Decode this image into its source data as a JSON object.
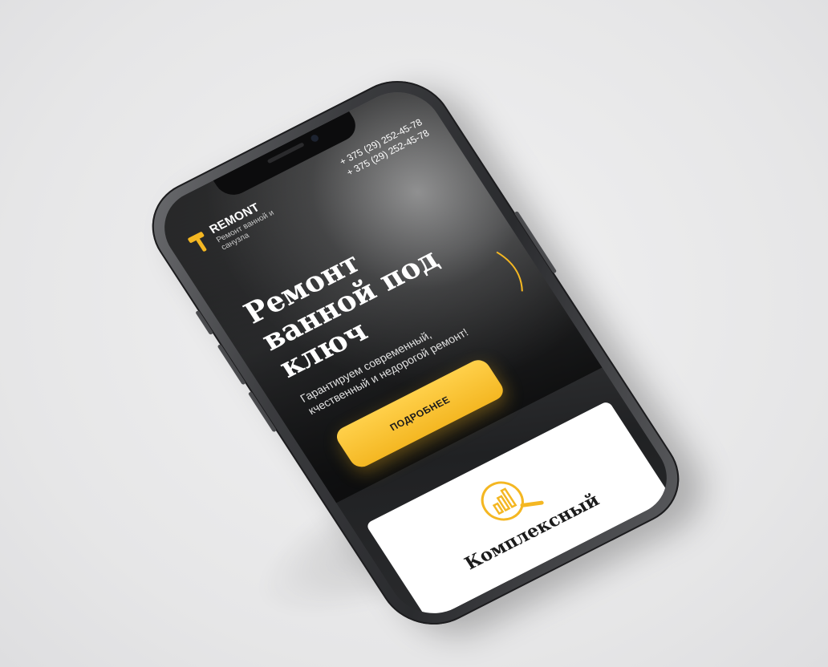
{
  "brand": {
    "name": "REMONT",
    "tagline": "Ремонт ванной и санузла",
    "accent_color": "#f4b722",
    "logo_icon": "hammer-icon"
  },
  "header": {
    "phones": [
      "+ 375 (29) 252-45-78",
      "+ 375 (29) 252-45-78"
    ]
  },
  "hero": {
    "title": "Ремонт ванной под ключ",
    "text": "Гарантируем современный, кчественный и недорогой ремонт!",
    "cta_label": "ПОДРОБНЕЕ"
  },
  "service_card": {
    "icon": "analytics-search-icon",
    "title": "Комплексный"
  }
}
